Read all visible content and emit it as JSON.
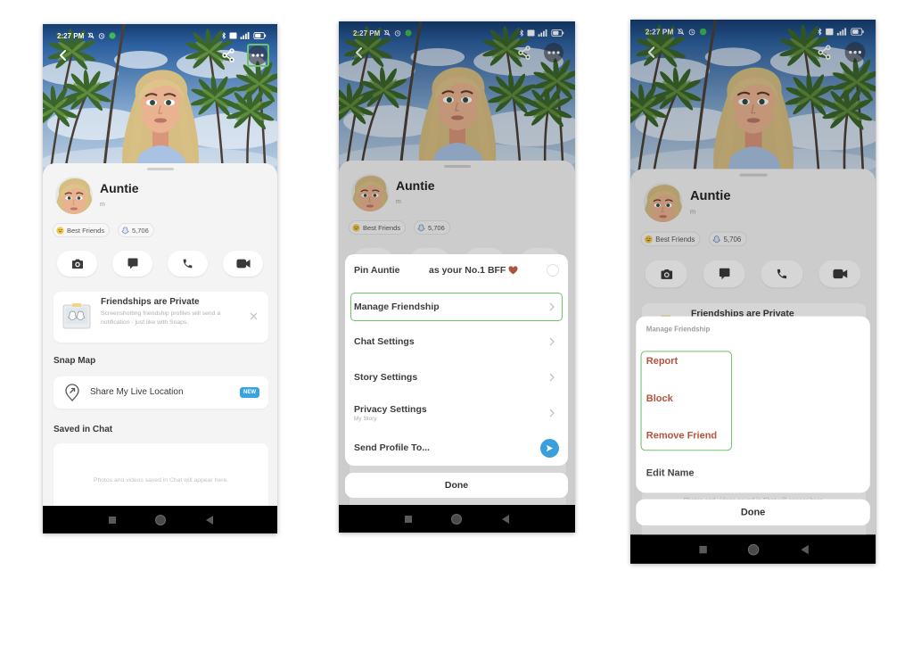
{
  "status_bar": {
    "time": "2:27 PM"
  },
  "profile": {
    "name": "Auntie",
    "username": "m",
    "friend_badge": {
      "label": "Best Friends",
      "icon": "grinning-face-icon"
    },
    "snap_score": {
      "label": "5,706",
      "icon": "snap-score-ghost-icon"
    },
    "header_buttons": [
      "back-icon",
      "share-icon",
      "more-options-icon"
    ],
    "actions": [
      {
        "icon": "camera-icon"
      },
      {
        "icon": "chat-icon"
      },
      {
        "icon": "phone-icon"
      },
      {
        "icon": "video-call-icon"
      }
    ],
    "privacy_card": {
      "title": "Friendships are Private",
      "description": "Screenshotting friendship profiles will send a notification - just like with Snaps."
    },
    "snap_map": {
      "heading": "Snap Map",
      "share_label": "Share My Live Location",
      "badge": "NEW"
    },
    "saved_in_chat": {
      "heading": "Saved in Chat",
      "empty_text": "Photos and videos saved in Chat will appear here."
    }
  },
  "screen_1": {
    "highlighted": "more-options-button"
  },
  "screen_2": {
    "menu": {
      "pin": {
        "label": "Pin Auntie",
        "suffix": "as your No.1 BFF"
      },
      "items": [
        {
          "label": "Manage Friendship",
          "highlighted": true
        },
        {
          "label": "Chat Settings"
        },
        {
          "label": "Story Settings"
        },
        {
          "label": "Privacy Settings",
          "sublabel": "My Story"
        },
        {
          "label": "Send Profile To..."
        }
      ]
    },
    "done_label": "Done"
  },
  "screen_3": {
    "menu": {
      "title": "Manage Friendship",
      "items": [
        {
          "label": "Report",
          "destructive": true,
          "highlighted": true
        },
        {
          "label": "Block",
          "destructive": true,
          "highlighted": true
        },
        {
          "label": "Remove Friend",
          "destructive": true,
          "highlighted": true
        },
        {
          "label": "Edit Name"
        }
      ]
    },
    "done_label": "Done"
  },
  "colors": {
    "highlight_outline": "#6cc36a",
    "destructive_text": "#b5533d",
    "send_button": "#3b9fdc",
    "new_badge": "#3aa3e3"
  }
}
